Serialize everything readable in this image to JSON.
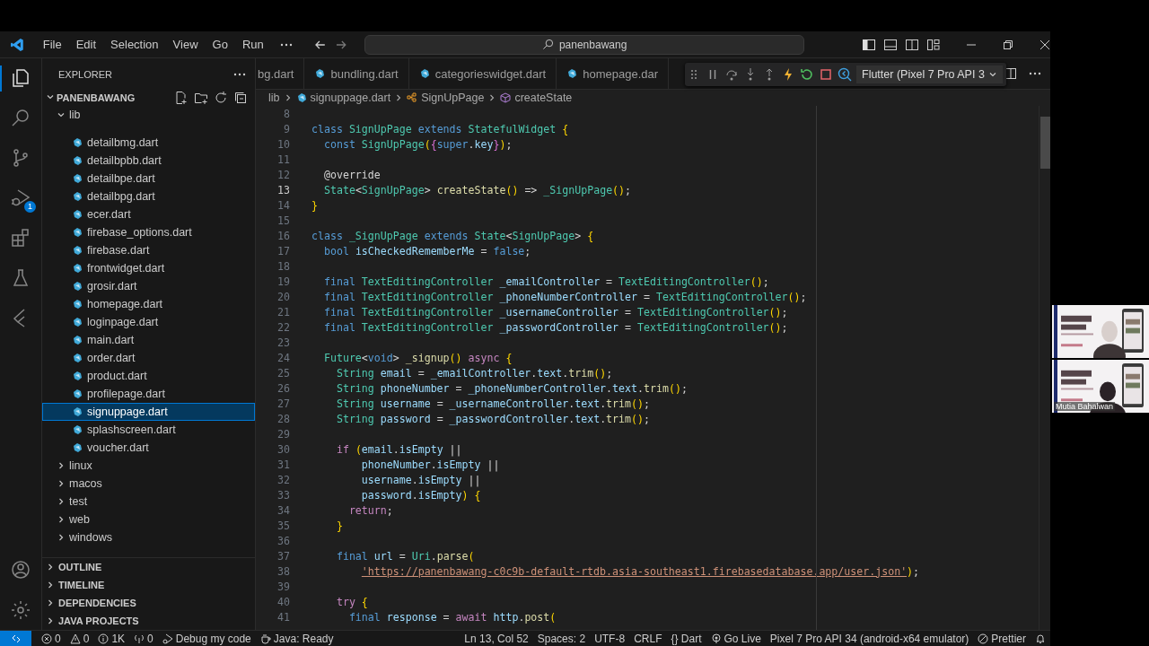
{
  "title_bar": {
    "menu": [
      "File",
      "Edit",
      "Selection",
      "View",
      "Go",
      "Run"
    ],
    "search": "panenbawang"
  },
  "activity_bar": {
    "top": [
      {
        "kind": "explorer",
        "selected": true
      },
      {
        "kind": "search",
        "selected": false
      },
      {
        "kind": "scm",
        "selected": false
      },
      {
        "kind": "debug",
        "selected": false,
        "badge": "1"
      },
      {
        "kind": "extensions",
        "selected": false
      },
      {
        "kind": "testing",
        "selected": false
      },
      {
        "kind": "flutter",
        "selected": false
      }
    ],
    "bottom": [
      {
        "kind": "account",
        "selected": false
      },
      {
        "kind": "settings",
        "selected": false
      }
    ]
  },
  "sidebar": {
    "title": "EXPLORER",
    "project": {
      "label": "PANENBAWANG",
      "expanded": true
    },
    "tree": [
      {
        "label": "lib",
        "expanded": true,
        "selected": false,
        "children": [
          {
            "label": "detailbmg.dart",
            "selected": false
          },
          {
            "label": "detailbpbb.dart",
            "selected": false
          },
          {
            "label": "detailbpe.dart",
            "selected": false
          },
          {
            "label": "detailbpg.dart",
            "selected": false
          },
          {
            "label": "ecer.dart",
            "selected": false
          },
          {
            "label": "firebase_options.dart",
            "selected": false
          },
          {
            "label": "firebase.dart",
            "selected": false
          },
          {
            "label": "frontwidget.dart",
            "selected": false
          },
          {
            "label": "grosir.dart",
            "selected": false
          },
          {
            "label": "homepage.dart",
            "selected": false
          },
          {
            "label": "loginpage.dart",
            "selected": false
          },
          {
            "label": "main.dart",
            "selected": false
          },
          {
            "label": "order.dart",
            "selected": false
          },
          {
            "label": "product.dart",
            "selected": false
          },
          {
            "label": "profilepage.dart",
            "selected": false
          },
          {
            "label": "signuppage.dart",
            "selected": true
          },
          {
            "label": "splashscreen.dart",
            "selected": false
          },
          {
            "label": "voucher.dart",
            "selected": false
          }
        ]
      },
      {
        "label": "linux",
        "expanded": false,
        "selected": false
      },
      {
        "label": "macos",
        "expanded": false,
        "selected": false
      },
      {
        "label": "test",
        "expanded": false,
        "selected": false
      },
      {
        "label": "web",
        "expanded": false,
        "selected": false
      },
      {
        "label": "windows",
        "expanded": false,
        "selected": false
      }
    ],
    "sections": [
      {
        "label": "OUTLINE",
        "expanded": false
      },
      {
        "label": "TIMELINE",
        "expanded": false
      },
      {
        "label": "DEPENDENCIES",
        "expanded": false
      },
      {
        "label": "JAVA PROJECTS",
        "expanded": false
      }
    ]
  },
  "tabs": [
    {
      "label": "bg.dart",
      "selected": false
    },
    {
      "label": "bundling.dart",
      "selected": false
    },
    {
      "label": "categorieswidget.dart",
      "selected": false
    },
    {
      "label": "homepage.dar",
      "selected": false
    }
  ],
  "debug_toolbar": {
    "target": "Flutter (Pixel 7 Pro API 3"
  },
  "breadcrumb": [
    {
      "kind": "folder",
      "label": "lib"
    },
    {
      "kind": "file",
      "label": "signuppage.dart"
    },
    {
      "kind": "class",
      "label": "SignUpPage"
    },
    {
      "kind": "method",
      "label": "createState"
    }
  ],
  "editor": {
    "lines": [
      {
        "number": "8",
        "current": false
      },
      {
        "number": "9",
        "current": false,
        "code": "class SignUpPage extends StatefulWidget {"
      },
      {
        "number": "10",
        "current": false,
        "code": "  const SignUpPage({super.key});"
      },
      {
        "number": "11",
        "current": false
      },
      {
        "number": "12",
        "current": false,
        "code": "  @override"
      },
      {
        "number": "13",
        "current": true,
        "code": "  State<SignUpPage> createState() => _SignUpPage();"
      },
      {
        "number": "14",
        "current": false,
        "code": "}"
      },
      {
        "number": "15",
        "current": false
      },
      {
        "number": "16",
        "current": false,
        "code": "class _SignUpPage extends State<SignUpPage> {"
      },
      {
        "number": "17",
        "current": false,
        "code": "  bool isCheckedRememberMe = false;"
      },
      {
        "number": "18",
        "current": false
      },
      {
        "number": "19",
        "current": false,
        "code": "  final TextEditingController _emailController = TextEditingController();"
      },
      {
        "number": "20",
        "current": false,
        "code": "  final TextEditingController _phoneNumberController = TextEditingController();"
      },
      {
        "number": "21",
        "current": false,
        "code": "  final TextEditingController _usernameController = TextEditingController();"
      },
      {
        "number": "22",
        "current": false,
        "code": "  final TextEditingController _passwordController = TextEditingController();"
      },
      {
        "number": "23",
        "current": false
      },
      {
        "number": "24",
        "current": false,
        "code": "  Future<void> _signup() async {"
      },
      {
        "number": "25",
        "current": false,
        "code": "    String email = _emailController.text.trim();"
      },
      {
        "number": "26",
        "current": false,
        "code": "    String phoneNumber = _phoneNumberController.text.trim();"
      },
      {
        "number": "27",
        "current": false,
        "code": "    String username = _usernameController.text.trim();"
      },
      {
        "number": "28",
        "current": false,
        "code": "    String password = _passwordController.text.trim();"
      },
      {
        "number": "29",
        "current": false
      },
      {
        "number": "30",
        "current": false,
        "code": "    if (email.isEmpty ||"
      },
      {
        "number": "31",
        "current": false,
        "code": "        phoneNumber.isEmpty ||"
      },
      {
        "number": "32",
        "current": false,
        "code": "        username.isEmpty ||"
      },
      {
        "number": "33",
        "current": false,
        "code": "        password.isEmpty) {"
      },
      {
        "number": "34",
        "current": false,
        "code": "      return;"
      },
      {
        "number": "35",
        "current": false,
        "code": "    }"
      },
      {
        "number": "36",
        "current": false
      },
      {
        "number": "37",
        "current": false,
        "code": "    final url = Uri.parse("
      },
      {
        "number": "38",
        "current": false,
        "code": "        'https://panenbawang-c0c9b-default-rtdb.asia-southeast1.firebasedatabase.app/user.json');"
      },
      {
        "number": "39",
        "current": false
      },
      {
        "number": "40",
        "current": false,
        "code": "    try {"
      },
      {
        "number": "41",
        "current": false,
        "code": "      final response = await http.post("
      }
    ]
  },
  "status_bar": {
    "left": [
      {
        "kind": "remote"
      },
      {
        "kind": "errors",
        "text": "0"
      },
      {
        "kind": "warnings",
        "text": "0"
      },
      {
        "kind": "info",
        "text": "1K"
      },
      {
        "kind": "ports",
        "text": "0"
      },
      {
        "kind": "debug",
        "text": "Debug my code"
      },
      {
        "kind": "java",
        "text": "Java: Ready"
      }
    ],
    "right": [
      {
        "kind": "plain",
        "text": "Ln 13, Col 52"
      },
      {
        "kind": "plain",
        "text": "Spaces: 2"
      },
      {
        "kind": "plain",
        "text": "UTF-8"
      },
      {
        "kind": "plain",
        "text": "CRLF"
      },
      {
        "kind": "plain",
        "text": "{} Dart"
      },
      {
        "kind": "golive",
        "text": "Go Live"
      },
      {
        "kind": "plain",
        "text": "Pixel 7 Pro API 34 (android-x64 emulator)"
      },
      {
        "kind": "prettier",
        "text": "Prettier"
      },
      {
        "kind": "bell"
      }
    ]
  },
  "video_call": {
    "tiles": [
      {
        "kind": "picture"
      },
      {
        "kind": "picture",
        "name": "Mutia Bahalwan"
      }
    ]
  }
}
